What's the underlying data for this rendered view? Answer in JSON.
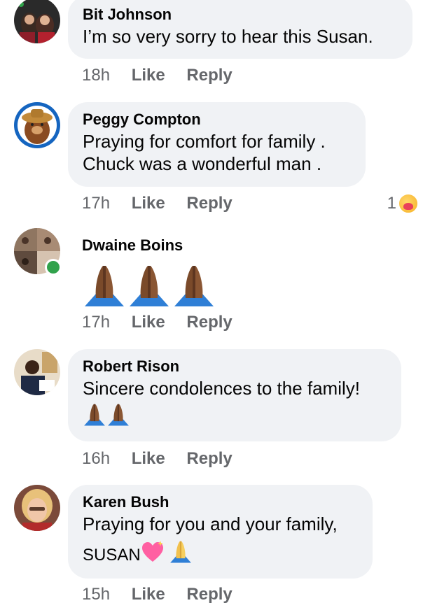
{
  "comments": [
    {
      "author": "Bit Johnson",
      "lines": [
        "I’m so very sorry to hear this Susan."
      ],
      "time": "18h",
      "like": "Like",
      "reply": "Reply"
    },
    {
      "author": "Peggy Compton",
      "lines": [
        "Praying for comfort for family .",
        "Chuck was a wonderful man ."
      ],
      "time": "17h",
      "like": "Like",
      "reply": "Reply",
      "reaction_count": "1",
      "reaction_icon": "care-reaction-icon"
    },
    {
      "author": "Dwaine Boins",
      "emoji": "folded-hands-icon x3",
      "time": "17h",
      "like": "Like",
      "reply": "Reply",
      "online": true
    },
    {
      "author": "Robert Rison",
      "lines": [
        "Sincere condolences to the family!"
      ],
      "emoji": "folded-hands-icon x2",
      "time": "16h",
      "like": "Like",
      "reply": "Reply"
    },
    {
      "author": "Karen Bush",
      "lines": [
        "Praying for you and your family,",
        "SUSAN"
      ],
      "emoji": "sparkling-heart-icon, folded-hands-icon",
      "time": "15h",
      "like": "Like",
      "reply": "Reply"
    }
  ],
  "colors": {
    "bubble": "#f0f2f5",
    "meta_text": "#65676b",
    "online": "#31a24c"
  }
}
